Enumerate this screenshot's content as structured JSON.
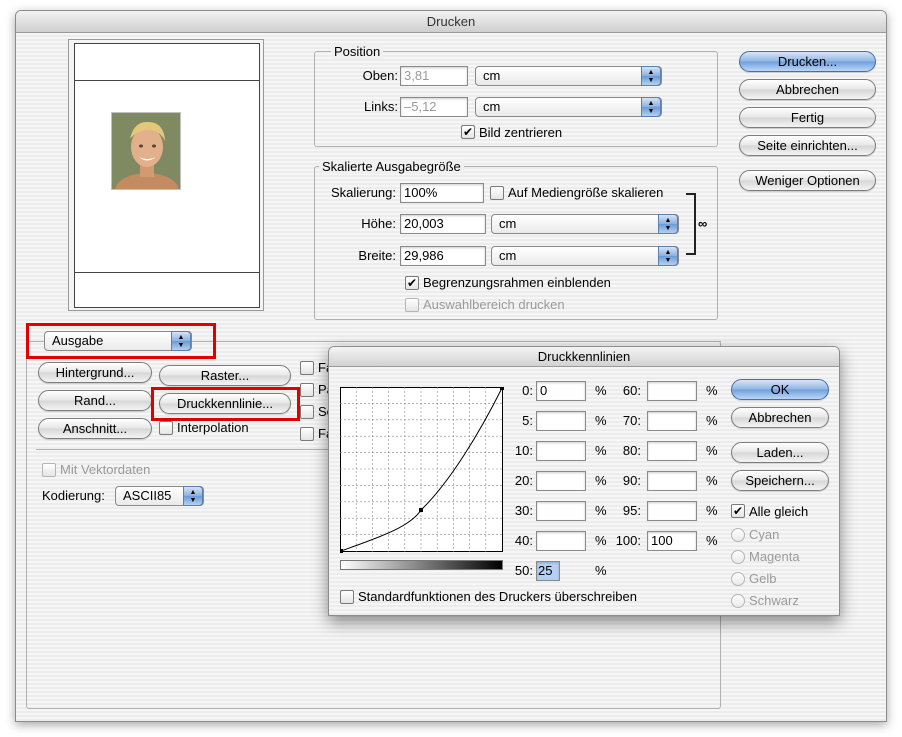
{
  "window": {
    "title": "Drucken"
  },
  "buttons": {
    "print": "Drucken...",
    "cancel": "Abbrechen",
    "done": "Fertig",
    "page_setup": "Seite einrichten...",
    "fewer_options": "Weniger Optionen"
  },
  "position": {
    "legend": "Position",
    "top_label": "Oben:",
    "top_value": "3,81",
    "top_unit": "cm",
    "left_label": "Links:",
    "left_value": "–5,12",
    "left_unit": "cm",
    "center_label": "Bild zentrieren",
    "center_checked": "✔"
  },
  "scaled": {
    "legend": "Skalierte Ausgabegröße",
    "scale_label": "Skalierung:",
    "scale_value": "100%",
    "fit_label": "Auf Mediengröße skalieren",
    "height_label": "Höhe:",
    "height_value": "20,003",
    "height_unit": "cm",
    "width_label": "Breite:",
    "width_value": "29,986",
    "width_unit": "cm",
    "bbox_label": "Begrenzungsrahmen einblenden",
    "bbox_checked": "✔",
    "selection_label": "Auswahlbereich drucken"
  },
  "output": {
    "dropdown": "Ausgabe",
    "background": "Hintergrund...",
    "screen": "Raster...",
    "border": "Rand...",
    "transfer": "Druckkennlinie...",
    "bleed": "Anschnitt...",
    "interpolation": "Interpolation",
    "partial_labels": [
      "Fa",
      "Pa",
      "Sc",
      "Fa"
    ],
    "vector_label": "Mit Vektordaten",
    "encoding_label": "Kodierung:",
    "encoding_value": "ASCII85"
  },
  "transfer_dialog": {
    "title": "Druckkennlinien",
    "left_fields": [
      {
        "label": "0:",
        "value": "0"
      },
      {
        "label": "5:",
        "value": ""
      },
      {
        "label": "10:",
        "value": ""
      },
      {
        "label": "20:",
        "value": ""
      },
      {
        "label": "30:",
        "value": ""
      },
      {
        "label": "40:",
        "value": ""
      },
      {
        "label": "50:",
        "value": "25"
      }
    ],
    "right_fields": [
      {
        "label": "60:",
        "value": ""
      },
      {
        "label": "70:",
        "value": ""
      },
      {
        "label": "80:",
        "value": ""
      },
      {
        "label": "90:",
        "value": ""
      },
      {
        "label": "95:",
        "value": ""
      },
      {
        "label": "100:",
        "value": "100"
      }
    ],
    "percent": "%",
    "ok": "OK",
    "cancel": "Abbrechen",
    "load": "Laden...",
    "save": "Speichern...",
    "all_same_label": "Alle gleich",
    "all_same_checked": "✔",
    "channels": [
      "Cyan",
      "Magenta",
      "Gelb",
      "Schwarz"
    ],
    "override_label": "Standardfunktionen des Druckers überschreiben"
  },
  "colors": {
    "highlight": "#e00000",
    "default_button": "#6e9fdd"
  },
  "icons": {
    "link": "chain-link-icon",
    "popup": "up-down-arrows-icon"
  }
}
